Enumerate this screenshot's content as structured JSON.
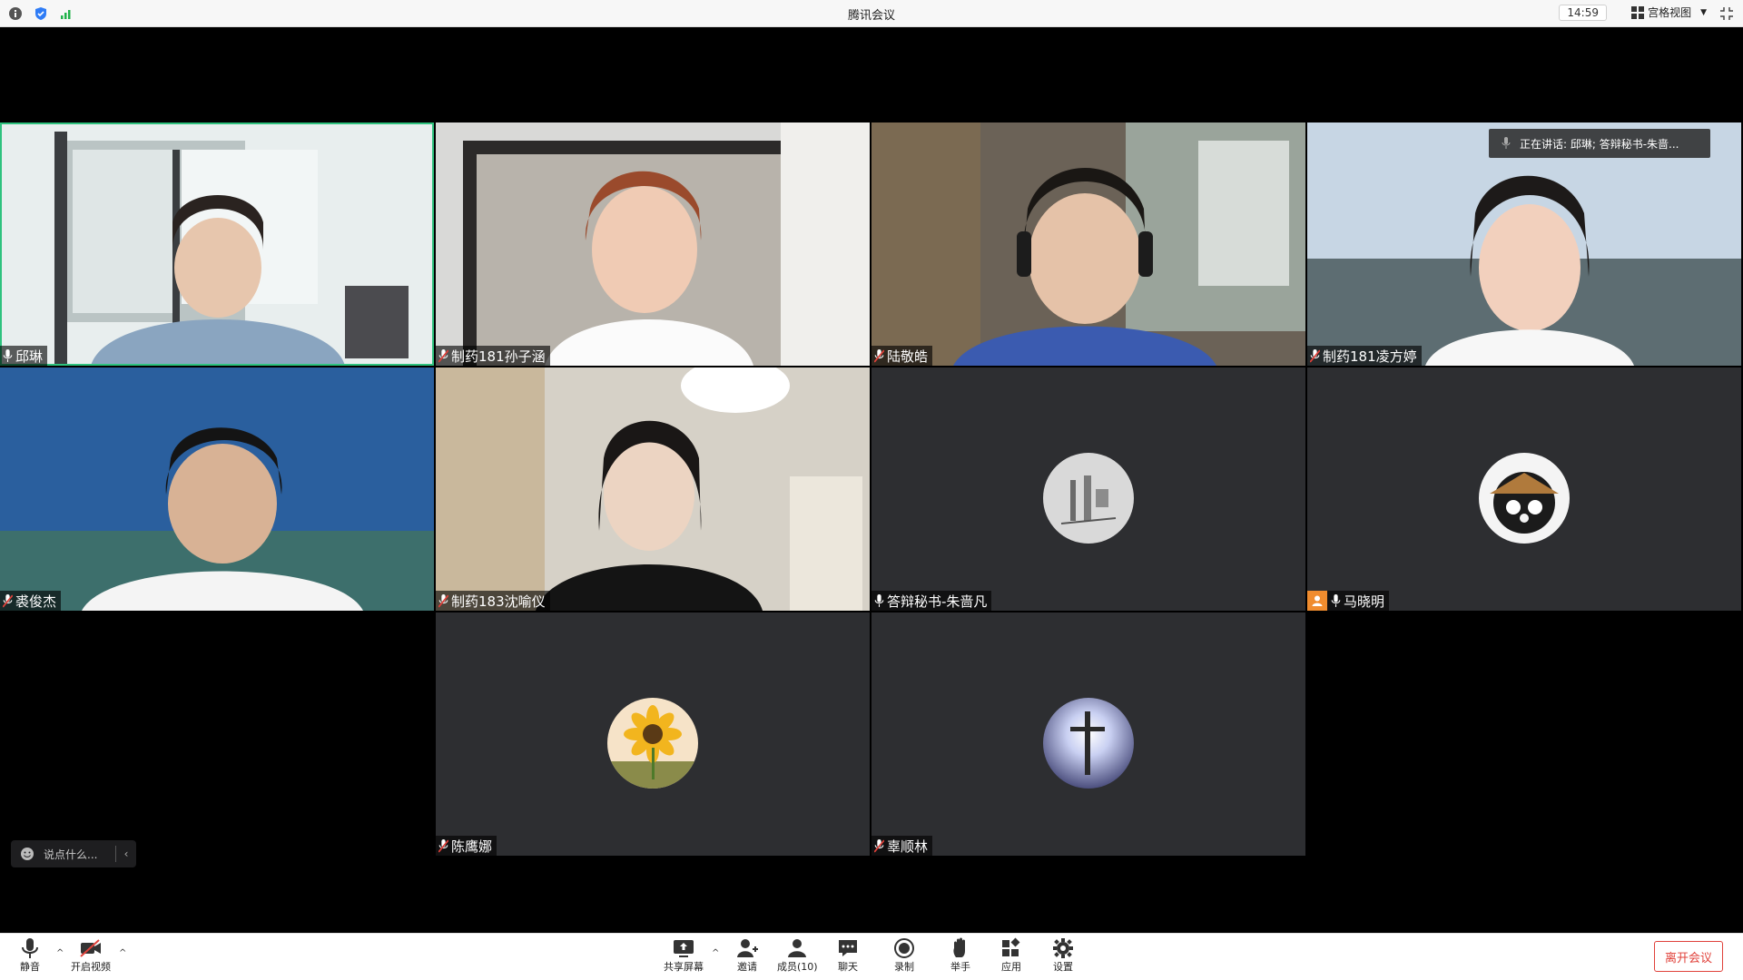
{
  "titlebar": {
    "title": "腾讯会议",
    "time": "14:59",
    "view_label": "宫格视图",
    "colors": {
      "info": "#444444",
      "shield": "#2f7cf6",
      "signal": "#20b24a"
    }
  },
  "speaking": {
    "text": "正在讲话: 邱琳; 答辩秘书-朱啬..."
  },
  "participants": [
    {
      "name": "邱琳",
      "mic": "on",
      "video": true
    },
    {
      "name": "制药181孙子涵",
      "mic": "muted",
      "video": true
    },
    {
      "name": "陆敬皓",
      "mic": "muted",
      "video": true
    },
    {
      "name": "制药181凌方婷",
      "mic": "muted",
      "video": true
    },
    {
      "name": "裘俊杰",
      "mic": "muted",
      "video": true
    },
    {
      "name": "制药183沈喻仪",
      "mic": "muted",
      "video": true
    },
    {
      "name": "答辩秘书-朱啬凡",
      "mic": "on",
      "video": false,
      "avatar": "equipment-avatar"
    },
    {
      "name": "马晓明",
      "mic": "on",
      "video": false,
      "avatar": "panda-avatar"
    },
    {
      "name": "陈鹰娜",
      "mic": "muted",
      "video": false,
      "avatar": "sunflower-avatar"
    },
    {
      "name": "辜顺林",
      "mic": "muted",
      "video": false,
      "avatar": "cross-avatar"
    }
  ],
  "chat": {
    "placeholder": "说点什么..."
  },
  "toolbar": {
    "mute": "静音",
    "video": "开启视频",
    "share": "共享屏幕",
    "invite": "邀请",
    "members": "成员(10)",
    "chat": "聊天",
    "record": "录制",
    "raise_hand": "举手",
    "apps": "应用",
    "settings": "设置",
    "leave": "离开会议"
  }
}
